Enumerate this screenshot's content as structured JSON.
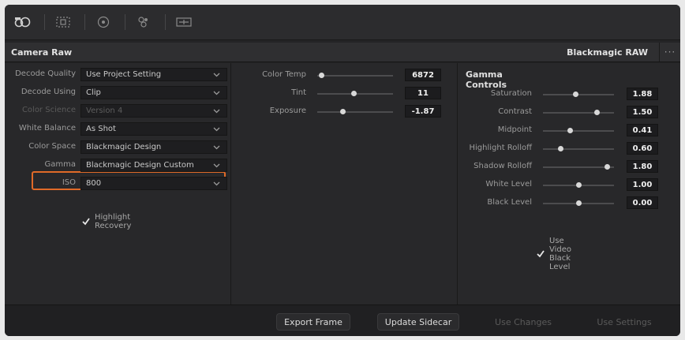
{
  "panel": {
    "title": "Camera Raw",
    "codec": "Blackmagic RAW"
  },
  "decode": {
    "fields": [
      {
        "label": "Decode Quality",
        "value": "Use Project Setting",
        "enabled": true
      },
      {
        "label": "Decode Using",
        "value": "Clip",
        "enabled": true
      },
      {
        "label": "Color Science",
        "value": "Version 4",
        "enabled": false
      },
      {
        "label": "White Balance",
        "value": "As Shot",
        "enabled": true
      },
      {
        "label": "Color Space",
        "value": "Blackmagic Design",
        "enabled": true
      },
      {
        "label": "Gamma",
        "value": "Blackmagic Design Custom",
        "enabled": true
      },
      {
        "label": "ISO",
        "value": "800",
        "enabled": true
      }
    ],
    "highlight_recovery": {
      "label": "Highlight Recovery",
      "checked": true
    }
  },
  "color": {
    "sliders": [
      {
        "label": "Color Temp",
        "value": "6872",
        "level": 0.05
      },
      {
        "label": "Tint",
        "value": "11",
        "level": 0.48
      },
      {
        "label": "Exposure",
        "value": "-1.87",
        "level": 0.33
      }
    ]
  },
  "gamma_controls": {
    "title": "Gamma Controls",
    "sliders": [
      {
        "label": "Saturation",
        "value": "1.88",
        "level": 0.45
      },
      {
        "label": "Contrast",
        "value": "1.50",
        "level": 0.75
      },
      {
        "label": "Midpoint",
        "value": "0.41",
        "level": 0.38
      },
      {
        "label": "Highlight Rolloff",
        "value": "0.60",
        "level": 0.24
      },
      {
        "label": "Shadow Rolloff",
        "value": "1.80",
        "level": 0.9
      },
      {
        "label": "White Level",
        "value": "1.00",
        "level": 0.5
      },
      {
        "label": "Black Level",
        "value": "0.00",
        "level": 0.5
      }
    ],
    "use_video_black_level": {
      "label": "Use Video Black Level",
      "checked": true
    }
  },
  "footer": {
    "export_frame": "Export Frame",
    "update_sidecar": "Update Sidecar",
    "use_changes": "Use Changes",
    "use_settings": "Use Settings"
  },
  "colors": {
    "highlight": "#e06a28",
    "background": "#242426"
  }
}
